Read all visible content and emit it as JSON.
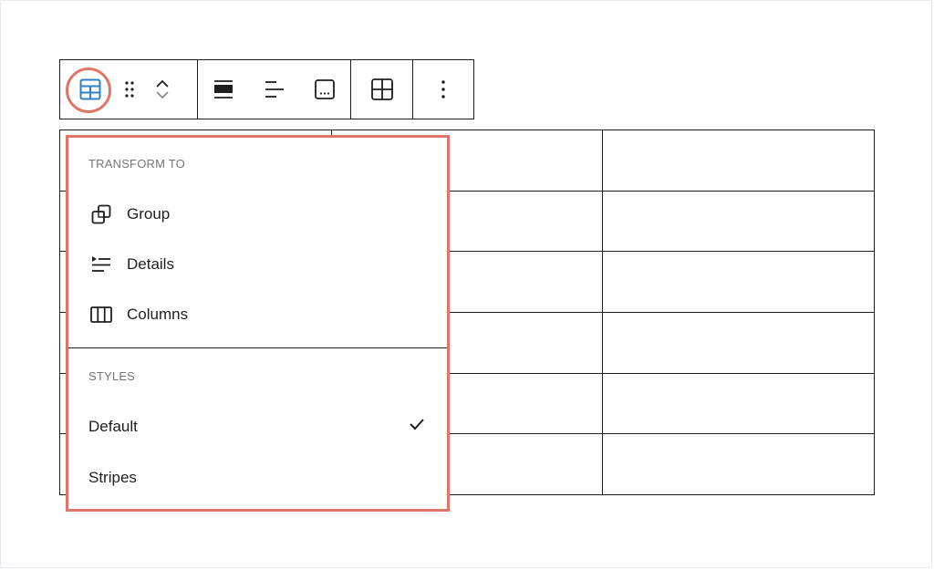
{
  "toolbar": {
    "block_type_icon": "table-icon",
    "drag_icon": "drag-handle-icon",
    "move_up_icon": "chevron-up-icon",
    "move_down_icon": "chevron-down-icon",
    "align_icon": "align-wide-icon",
    "text_align_icon": "align-left-icon",
    "caption_icon": "caption-icon",
    "edit_table_icon": "table-grid-icon",
    "more_options_icon": "more-vertical-icon"
  },
  "table": {
    "rows": 6,
    "columns": 3
  },
  "dropdown": {
    "transform_label": "TRANSFORM TO",
    "transform_items": [
      {
        "label": "Group",
        "icon": "group-icon"
      },
      {
        "label": "Details",
        "icon": "details-icon"
      },
      {
        "label": "Columns",
        "icon": "columns-icon"
      }
    ],
    "styles_label": "STYLES",
    "style_items": [
      {
        "label": "Default",
        "selected": true
      },
      {
        "label": "Stripes",
        "selected": false
      }
    ],
    "check_icon": "check-icon"
  },
  "colors": {
    "highlight": "#e0766a",
    "accent": "#3858e9",
    "text": "#1e1e1e",
    "muted": "#757575"
  }
}
